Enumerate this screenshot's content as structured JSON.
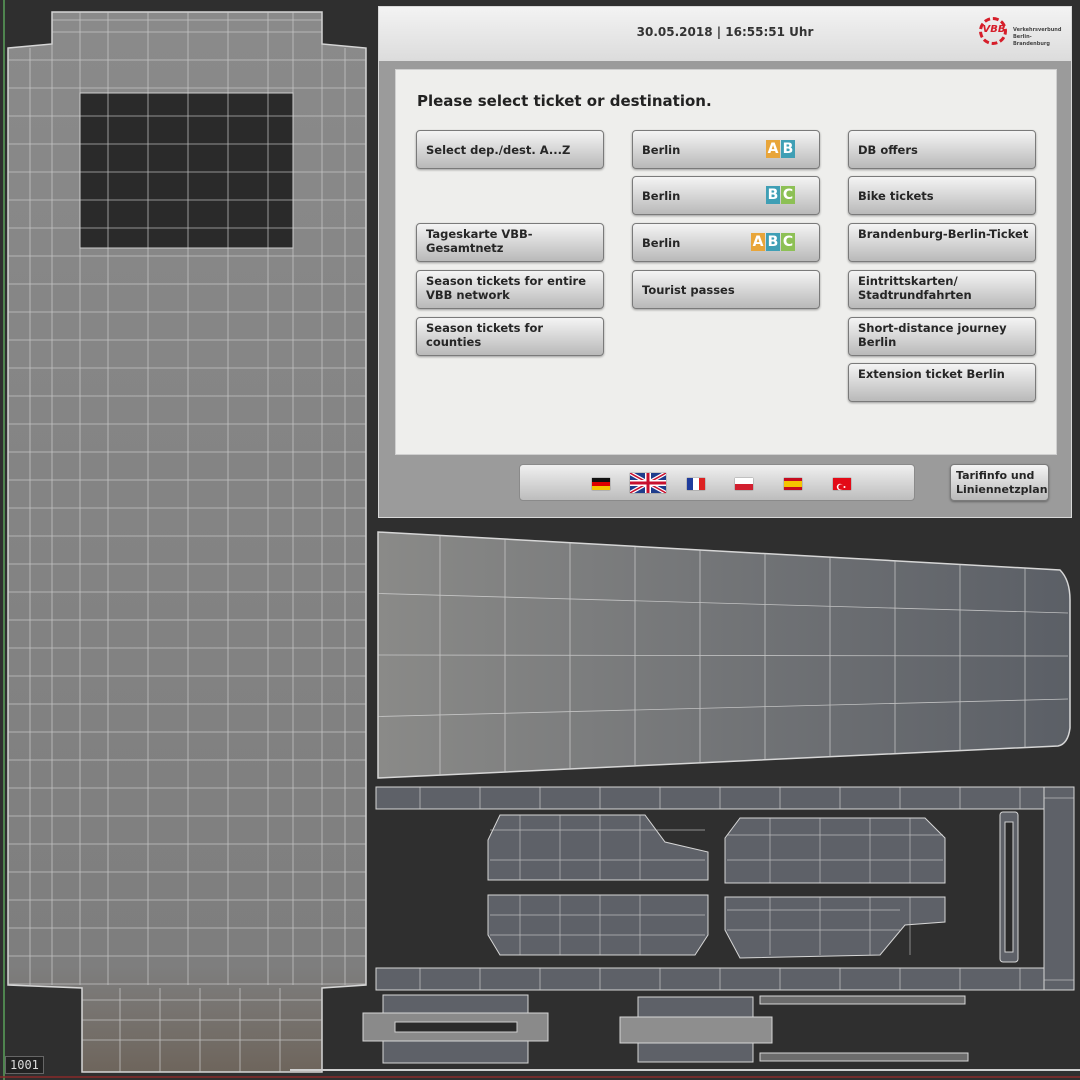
{
  "colors": {
    "background": "#2f2f2f",
    "wireframe": "#d6d6d6",
    "accent_red": "#d61e2a",
    "zone_a": "#e8a53a",
    "zone_b": "#3f9fb5",
    "zone_c": "#8dc055"
  },
  "screen": {
    "datetime": "30.05.2018 | 16:55:51 Uhr",
    "logo": {
      "mark": "VBB",
      "text": [
        "Verkehrsverbund",
        "Berlin-Brandenburg"
      ]
    },
    "prompt": "Please select ticket or destination.",
    "buttons": [
      {
        "label": "Select dep./dest. A...Z"
      },
      {
        "label": "Tageskarte VBB-Gesamtnetz"
      },
      {
        "label": "Season tickets for entire VBB network"
      },
      {
        "label": "Season tickets for counties"
      },
      {
        "label": "Berlin",
        "zones": [
          "A",
          "B"
        ]
      },
      {
        "label": "Berlin",
        "zones": [
          "B",
          "C"
        ]
      },
      {
        "label": "Berlin",
        "zones": [
          "A",
          "B",
          "C"
        ]
      },
      {
        "label": "Tourist passes"
      },
      {
        "label": "DB offers"
      },
      {
        "label": "Bike tickets"
      },
      {
        "label": "Brandenburg-Berlin-Ticket"
      },
      {
        "label": "Eintrittskarten/ Stadtrundfahrten"
      },
      {
        "label": "Short-distance journey Berlin"
      },
      {
        "label": "Extension ticket Berlin"
      }
    ],
    "languages": [
      "german-flag-icon",
      "uk-flag-icon",
      "france-flag-icon",
      "poland-flag-icon",
      "spain-flag-icon",
      "turkey-flag-icon"
    ],
    "tarif_button": "Tarifinfo und Liniennetzplan"
  },
  "tile_label": "1001"
}
